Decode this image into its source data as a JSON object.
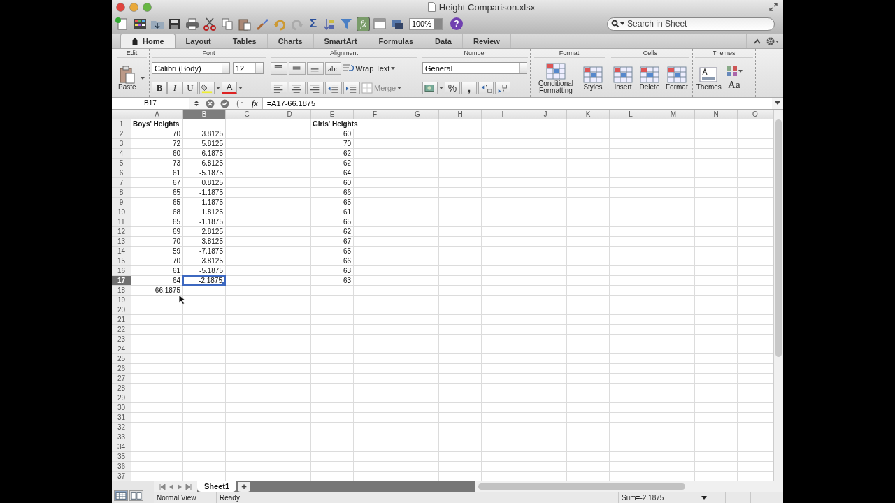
{
  "window": {
    "title": "Height Comparison.xlsx"
  },
  "toolbar": {
    "sum": "Σ",
    "function": "fx",
    "zoom": "100%",
    "help": "?"
  },
  "search": {
    "placeholder": "Search in Sheet"
  },
  "ribbon": {
    "tabs": [
      {
        "label": "Home",
        "selected": true
      },
      {
        "label": "Layout",
        "selected": false
      },
      {
        "label": "Tables",
        "selected": false
      },
      {
        "label": "Charts",
        "selected": false
      },
      {
        "label": "SmartArt",
        "selected": false
      },
      {
        "label": "Formulas",
        "selected": false
      },
      {
        "label": "Data",
        "selected": false
      },
      {
        "label": "Review",
        "selected": false
      }
    ],
    "groups": [
      {
        "kind": "edit",
        "title": "Edit",
        "buttons": [
          "Paste"
        ]
      },
      {
        "kind": "font",
        "title": "Font",
        "font_name": "Calibri (Body)",
        "font_size": "12",
        "styles": [
          "B",
          "I",
          "U"
        ],
        "color_letter": "A"
      },
      {
        "kind": "alignment",
        "title": "Alignment",
        "orientation": "abc",
        "wrap": "Wrap Text",
        "merge": "Merge"
      },
      {
        "kind": "number",
        "title": "Number",
        "format": "General",
        "percent": "%",
        "comma": ","
      },
      {
        "kind": "large",
        "title": "Format",
        "buttons": [
          "Conditional Formatting",
          "Styles"
        ]
      },
      {
        "kind": "large",
        "title": "Cells",
        "buttons": [
          "Insert",
          "Delete",
          "Format"
        ]
      },
      {
        "kind": "themes",
        "title": "Themes",
        "buttons": [
          "Themes"
        ],
        "font_glyph": "Aa"
      }
    ]
  },
  "formula_bar": {
    "name_box": "B17",
    "function": "fx",
    "formula": "=A17-66.1875"
  },
  "sheet": {
    "columns": [
      {
        "label": "A",
        "selected": false
      },
      {
        "label": "B",
        "selected": true
      },
      {
        "label": "C",
        "selected": false
      },
      {
        "label": "D",
        "selected": false
      },
      {
        "label": "E",
        "selected": false
      },
      {
        "label": "F",
        "selected": false
      },
      {
        "label": "G",
        "selected": false
      },
      {
        "label": "H",
        "selected": false
      },
      {
        "label": "I",
        "selected": false
      },
      {
        "label": "J",
        "selected": false
      },
      {
        "label": "K",
        "selected": false
      },
      {
        "label": "L",
        "selected": false
      },
      {
        "label": "M",
        "selected": false
      },
      {
        "label": "N",
        "selected": false
      },
      {
        "label": "O",
        "selected": false
      }
    ],
    "rows": [
      {
        "number": "1",
        "selected": false,
        "cells": [
          {
            "text": "Boys' Heights",
            "kind": "label",
            "selected": false
          },
          null,
          null,
          null,
          {
            "text": "Girls' Heights",
            "kind": "label",
            "selected": false
          }
        ]
      },
      {
        "number": "2",
        "selected": false,
        "cells": [
          {
            "text": "70",
            "kind": "number",
            "selected": false
          },
          {
            "text": "3.8125",
            "kind": "number",
            "selected": false
          },
          null,
          null,
          {
            "text": "60",
            "kind": "number",
            "selected": false
          }
        ]
      },
      {
        "number": "3",
        "selected": false,
        "cells": [
          {
            "text": "72",
            "kind": "number",
            "selected": false
          },
          {
            "text": "5.8125",
            "kind": "number",
            "selected": false
          },
          null,
          null,
          {
            "text": "70",
            "kind": "number",
            "selected": false
          }
        ]
      },
      {
        "number": "4",
        "selected": false,
        "cells": [
          {
            "text": "60",
            "kind": "number",
            "selected": false
          },
          {
            "text": "-6.1875",
            "kind": "number",
            "selected": false
          },
          null,
          null,
          {
            "text": "62",
            "kind": "number",
            "selected": false
          }
        ]
      },
      {
        "number": "5",
        "selected": false,
        "cells": [
          {
            "text": "73",
            "kind": "number",
            "selected": false
          },
          {
            "text": "6.8125",
            "kind": "number",
            "selected": false
          },
          null,
          null,
          {
            "text": "62",
            "kind": "number",
            "selected": false
          }
        ]
      },
      {
        "number": "6",
        "selected": false,
        "cells": [
          {
            "text": "61",
            "kind": "number",
            "selected": false
          },
          {
            "text": "-5.1875",
            "kind": "number",
            "selected": false
          },
          null,
          null,
          {
            "text": "64",
            "kind": "number",
            "selected": false
          }
        ]
      },
      {
        "number": "7",
        "selected": false,
        "cells": [
          {
            "text": "67",
            "kind": "number",
            "selected": false
          },
          {
            "text": "0.8125",
            "kind": "number",
            "selected": false
          },
          null,
          null,
          {
            "text": "60",
            "kind": "number",
            "selected": false
          }
        ]
      },
      {
        "number": "8",
        "selected": false,
        "cells": [
          {
            "text": "65",
            "kind": "number",
            "selected": false
          },
          {
            "text": "-1.1875",
            "kind": "number",
            "selected": false
          },
          null,
          null,
          {
            "text": "66",
            "kind": "number",
            "selected": false
          }
        ]
      },
      {
        "number": "9",
        "selected": false,
        "cells": [
          {
            "text": "65",
            "kind": "number",
            "selected": false
          },
          {
            "text": "-1.1875",
            "kind": "number",
            "selected": false
          },
          null,
          null,
          {
            "text": "65",
            "kind": "number",
            "selected": false
          }
        ]
      },
      {
        "number": "10",
        "selected": false,
        "cells": [
          {
            "text": "68",
            "kind": "number",
            "selected": false
          },
          {
            "text": "1.8125",
            "kind": "number",
            "selected": false
          },
          null,
          null,
          {
            "text": "61",
            "kind": "number",
            "selected": false
          }
        ]
      },
      {
        "number": "11",
        "selected": false,
        "cells": [
          {
            "text": "65",
            "kind": "number",
            "selected": false
          },
          {
            "text": "-1.1875",
            "kind": "number",
            "selected": false
          },
          null,
          null,
          {
            "text": "65",
            "kind": "number",
            "selected": false
          }
        ]
      },
      {
        "number": "12",
        "selected": false,
        "cells": [
          {
            "text": "69",
            "kind": "number",
            "selected": false
          },
          {
            "text": "2.8125",
            "kind": "number",
            "selected": false
          },
          null,
          null,
          {
            "text": "62",
            "kind": "number",
            "selected": false
          }
        ]
      },
      {
        "number": "13",
        "selected": false,
        "cells": [
          {
            "text": "70",
            "kind": "number",
            "selected": false
          },
          {
            "text": "3.8125",
            "kind": "number",
            "selected": false
          },
          null,
          null,
          {
            "text": "67",
            "kind": "number",
            "selected": false
          }
        ]
      },
      {
        "number": "14",
        "selected": false,
        "cells": [
          {
            "text": "59",
            "kind": "number",
            "selected": false
          },
          {
            "text": "-7.1875",
            "kind": "number",
            "selected": false
          },
          null,
          null,
          {
            "text": "65",
            "kind": "number",
            "selected": false
          }
        ]
      },
      {
        "number": "15",
        "selected": false,
        "cells": [
          {
            "text": "70",
            "kind": "number",
            "selected": false
          },
          {
            "text": "3.8125",
            "kind": "number",
            "selected": false
          },
          null,
          null,
          {
            "text": "66",
            "kind": "number",
            "selected": false
          }
        ]
      },
      {
        "number": "16",
        "selected": false,
        "cells": [
          {
            "text": "61",
            "kind": "number",
            "selected": false
          },
          {
            "text": "-5.1875",
            "kind": "number",
            "selected": false
          },
          null,
          null,
          {
            "text": "63",
            "kind": "number",
            "selected": false
          }
        ]
      },
      {
        "number": "17",
        "selected": true,
        "cells": [
          {
            "text": "64",
            "kind": "number",
            "selected": false
          },
          {
            "text": "-2.1875",
            "kind": "number",
            "selected": true
          },
          null,
          null,
          {
            "text": "63",
            "kind": "number",
            "selected": false
          }
        ]
      },
      {
        "number": "18",
        "selected": false,
        "cells": [
          {
            "text": "66.1875",
            "kind": "number",
            "selected": false
          }
        ]
      },
      {
        "number": "19",
        "selected": false
      },
      {
        "number": "20",
        "selected": false
      },
      {
        "number": "21",
        "selected": false
      },
      {
        "number": "22",
        "selected": false
      },
      {
        "number": "23",
        "selected": false
      },
      {
        "number": "24",
        "selected": false
      },
      {
        "number": "25",
        "selected": false
      },
      {
        "number": "26",
        "selected": false
      },
      {
        "number": "27",
        "selected": false
      },
      {
        "number": "28",
        "selected": false
      },
      {
        "number": "29",
        "selected": false
      },
      {
        "number": "30",
        "selected": false
      },
      {
        "number": "31",
        "selected": false
      },
      {
        "number": "32",
        "selected": false
      },
      {
        "number": "33",
        "selected": false
      },
      {
        "number": "34",
        "selected": false
      },
      {
        "number": "35",
        "selected": false
      },
      {
        "number": "36",
        "selected": false
      },
      {
        "number": "37",
        "selected": false
      }
    ]
  },
  "sheet_tabs": {
    "tabs": [
      {
        "label": "Sheet1",
        "selected": true
      }
    ],
    "add": "+"
  },
  "status_bar": {
    "views": [
      {
        "kind": "normal",
        "selected": true
      },
      {
        "kind": "page_layout",
        "selected": false
      }
    ],
    "view_label": "Normal View",
    "mode": "Ready",
    "sum": "Sum=-2.1875"
  }
}
